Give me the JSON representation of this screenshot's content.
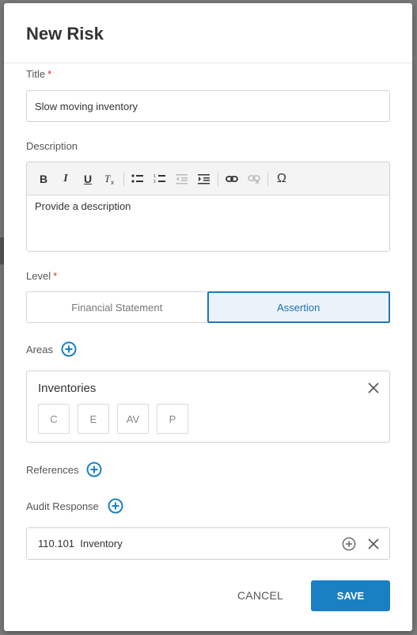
{
  "dialog": {
    "title": "New Risk"
  },
  "title_field": {
    "label": "Title",
    "required": "*",
    "value": "Slow moving inventory"
  },
  "description_field": {
    "label": "Description",
    "placeholder": "Provide a description",
    "toolbar": {
      "bold": "B",
      "italic": "I",
      "underline": "U",
      "clear_format": "Tx",
      "bullet_list": "bulleted-list-icon",
      "numbered_list": "numbered-list-icon",
      "outdent": "outdent-icon",
      "indent": "indent-icon",
      "link": "link-icon",
      "unlink": "unlink-icon",
      "special_char": "Ω"
    }
  },
  "level_field": {
    "label": "Level",
    "required": "*",
    "options": [
      "Financial Statement",
      "Assertion"
    ],
    "selected": "Assertion"
  },
  "areas": {
    "label": "Areas",
    "items": [
      {
        "name": "Inventories",
        "assertions": [
          "C",
          "E",
          "AV",
          "P"
        ]
      }
    ]
  },
  "references": {
    "label": "References"
  },
  "audit_response": {
    "label": "Audit Response",
    "items": [
      {
        "text": "110.101  Inventory"
      }
    ]
  },
  "footer": {
    "cancel_label": "CANCEL",
    "save_label": "SAVE"
  },
  "colors": {
    "accent": "#1a80c4",
    "required": "#d0342c",
    "selected_bg": "#eaf3fa"
  }
}
